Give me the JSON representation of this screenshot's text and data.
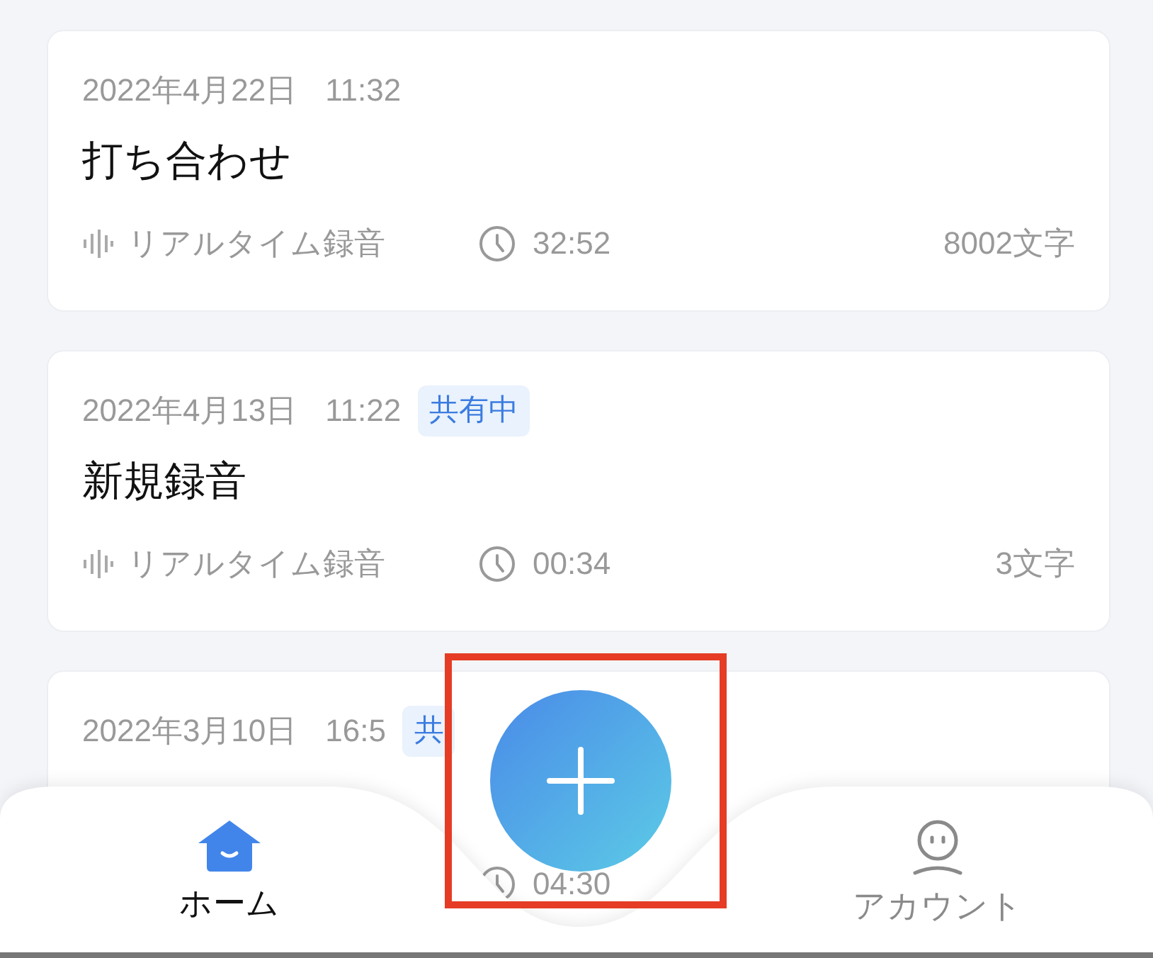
{
  "recordings": [
    {
      "date": "2022年4月22日",
      "time": "11:32",
      "title": "打ち合わせ",
      "source": "リアルタイム録音",
      "duration": "32:52",
      "characters": "8002文字"
    },
    {
      "date": "2022年4月13日",
      "time": "11:22",
      "badge": "共有中",
      "title": "新規録音",
      "source": "リアルタイム録音",
      "duration": "00:34",
      "characters": "3文字"
    },
    {
      "date": "2022年3月10日",
      "time": "16:5",
      "badge": "共",
      "duration": "04:30"
    }
  ],
  "annotation": {
    "kind": "highlight-frame"
  },
  "tab_bar": [
    {
      "kind": "home",
      "label": "ホーム",
      "selected": true
    },
    {
      "kind": "account",
      "label": "アカウント",
      "selected": false
    }
  ]
}
